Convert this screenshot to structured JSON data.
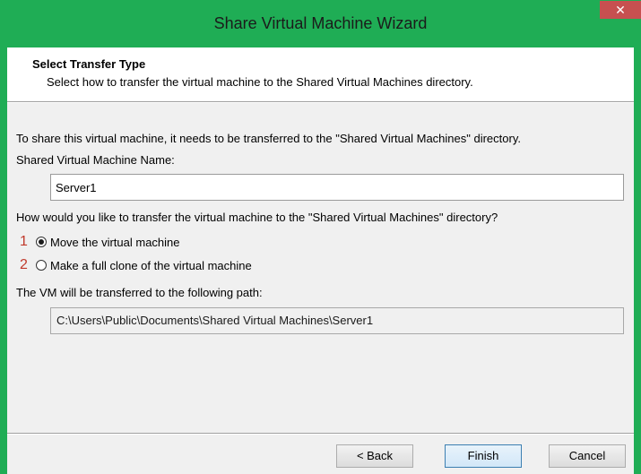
{
  "window": {
    "title": "Share Virtual Machine Wizard",
    "close_glyph": "✕",
    "accent_color": "#1fad55"
  },
  "header": {
    "title": "Select Transfer Type",
    "subtitle": "Select how to transfer the virtual machine to the Shared Virtual Machines directory."
  },
  "body": {
    "intro": "To share this virtual machine, it needs to be transferred to the \"Shared Virtual Machines\" directory.",
    "name_label": "Shared Virtual Machine Name:",
    "name_value": "Server1",
    "transfer_question": "How would you like to transfer the virtual machine to the \"Shared Virtual Machines\" directory?",
    "options": [
      {
        "number": "1",
        "label": "Move the virtual machine",
        "selected": true
      },
      {
        "number": "2",
        "label": "Make a full clone of the virtual machine",
        "selected": false
      }
    ],
    "path_label": "The VM will be transferred to the following path:",
    "path_value": "C:\\Users\\Public\\Documents\\Shared Virtual Machines\\Server1"
  },
  "footer": {
    "back_label": "< Back",
    "finish_label": "Finish",
    "cancel_label": "Cancel"
  }
}
